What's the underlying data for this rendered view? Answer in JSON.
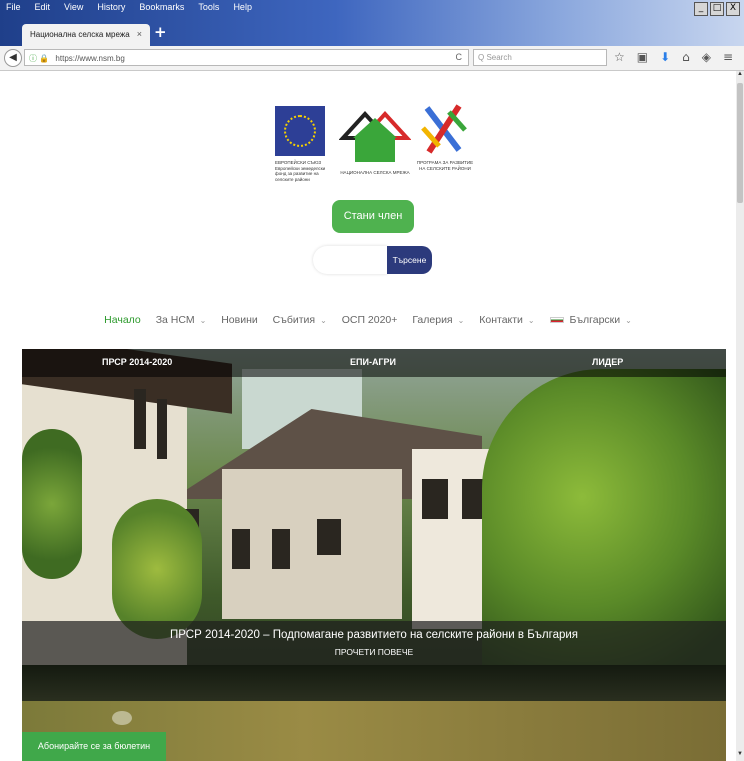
{
  "browser": {
    "menu": [
      "File",
      "Edit",
      "View",
      "History",
      "Bookmarks",
      "Tools",
      "Help"
    ],
    "window_controls": [
      "_",
      "□",
      "X"
    ],
    "tab_title": "Национална селска мрежа",
    "tab_close": "×",
    "new_tab": "+",
    "url": "https://www.nsm.bg",
    "search_placeholder": "Q Search",
    "toolbar_icons": [
      "star-icon",
      "clipboard-icon",
      "download-icon",
      "home-icon",
      "pocket-icon",
      "menu-icon"
    ]
  },
  "logos": {
    "eu_caption": "ЕВРОПЕЙСКИ СЪЮЗ Европейски земеделски фонд за развитие на селските райони",
    "nsm_caption": "НАЦИОНАЛНА СЕЛСКА МРЕЖА",
    "prsr_caption": "ПРОГРАМА ЗА РАЗВИТИЕ НА СЕЛСКИТЕ РАЙОНИ"
  },
  "join_button": "Стани член",
  "search": {
    "placeholder": "",
    "button": "Търсене"
  },
  "nav": {
    "items": [
      {
        "label": "Начало",
        "dropdown": false,
        "active": true
      },
      {
        "label": "За НСМ",
        "dropdown": true
      },
      {
        "label": "Новини",
        "dropdown": false
      },
      {
        "label": "Събития",
        "dropdown": true
      },
      {
        "label": "ОСП 2020+",
        "dropdown": false
      },
      {
        "label": "Галерия",
        "dropdown": true
      },
      {
        "label": "Контакти",
        "dropdown": true
      }
    ],
    "language": "Български",
    "caret": "⌄"
  },
  "hero": {
    "tabs": [
      "ПРСР 2014-2020",
      "ЕПИ-АГРИ",
      "ЛИДЕР"
    ],
    "caption": "ПРСР 2014-2020 – Подпомагане развитието на селските райони в България",
    "more": "ПРОЧЕТИ ПОВЕЧЕ"
  },
  "newsletter": "Абонирайте се за бюлетин",
  "colors": {
    "accent_green": "#4fb24f",
    "search_blue": "#2c3a7c",
    "active_nav": "#2d9a2d"
  }
}
